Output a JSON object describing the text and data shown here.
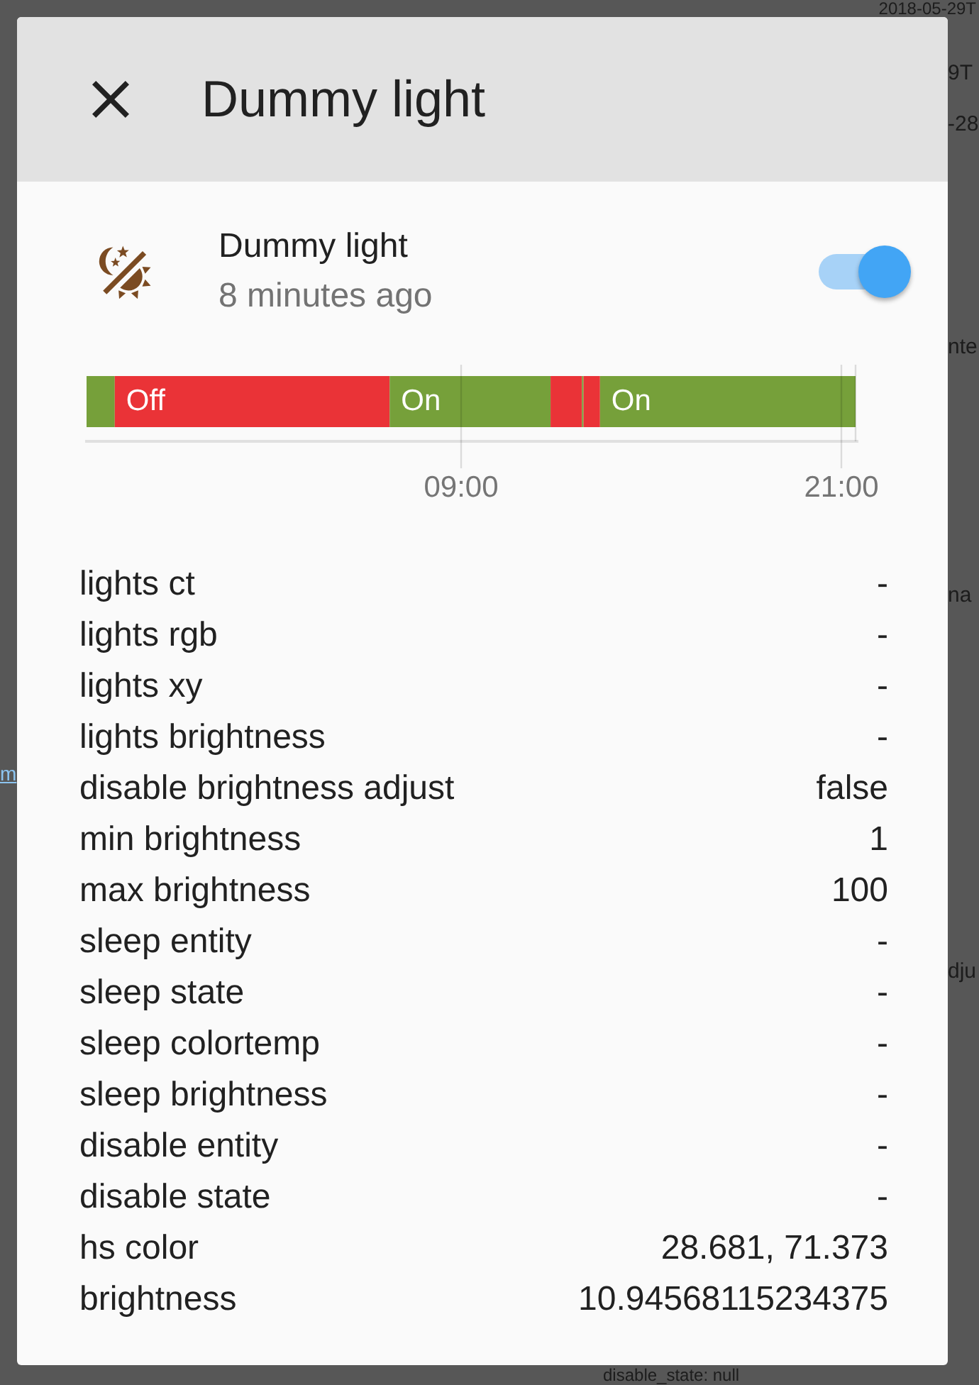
{
  "dialog": {
    "title": "Dummy light"
  },
  "entity": {
    "name": "Dummy light",
    "last_changed": "8 minutes ago",
    "on": true
  },
  "history": {
    "segments": [
      {
        "color": "#76a03a"
      },
      {
        "color": "#ea3337",
        "label": "Off"
      },
      {
        "color": "#76a03a",
        "label": "On"
      },
      {
        "color": "#ea3337"
      },
      {
        "color": "#76a03a"
      },
      {
        "color": "#ea3337"
      },
      {
        "color": "#76a03a",
        "label": "On"
      }
    ],
    "time_labels": [
      "09:00",
      "21:00"
    ]
  },
  "attributes": [
    {
      "name": "lights ct",
      "value": "-"
    },
    {
      "name": "lights rgb",
      "value": "-"
    },
    {
      "name": "lights xy",
      "value": "-"
    },
    {
      "name": "lights brightness",
      "value": "-"
    },
    {
      "name": "disable brightness adjust",
      "value": "false"
    },
    {
      "name": "min brightness",
      "value": "1"
    },
    {
      "name": "max brightness",
      "value": "100"
    },
    {
      "name": "sleep entity",
      "value": "-"
    },
    {
      "name": "sleep state",
      "value": "-"
    },
    {
      "name": "sleep colortemp",
      "value": "-"
    },
    {
      "name": "sleep brightness",
      "value": "-"
    },
    {
      "name": "disable entity",
      "value": "-"
    },
    {
      "name": "disable state",
      "value": "-"
    },
    {
      "name": "hs color",
      "value": "28.681, 71.373"
    },
    {
      "name": "brightness",
      "value": "10.94568115234375"
    }
  ],
  "background": {
    "top_edge": [
      "2018-05-29T"
    ],
    "left_edge": [
      {
        "kind": "link",
        "text": "m"
      }
    ],
    "right_edge": [
      "9T",
      "-28",
      "nte",
      "na",
      "dju"
    ],
    "bottom_edge": [
      "disable_state: null"
    ]
  }
}
